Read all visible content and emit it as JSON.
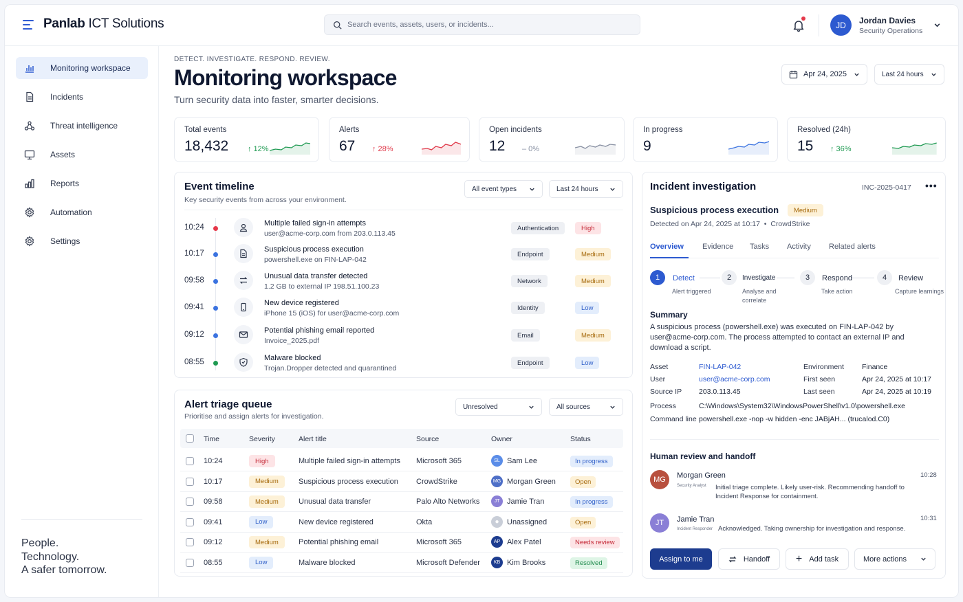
{
  "brand": {
    "name_bold": "Panlab",
    "name_rest": " ICT Solutions"
  },
  "search": {
    "placeholder": "Search events, assets, users, or incidents..."
  },
  "user": {
    "initials": "JD",
    "name": "Jordan Davies",
    "role": "Security Operations"
  },
  "sidebar": {
    "items": [
      {
        "label": "Monitoring workspace",
        "icon": "bar-chart-icon"
      },
      {
        "label": "Incidents",
        "icon": "document-icon"
      },
      {
        "label": "Threat intelligence",
        "icon": "network-icon"
      },
      {
        "label": "Assets",
        "icon": "monitor-icon"
      },
      {
        "label": "Reports",
        "icon": "reports-icon"
      },
      {
        "label": "Automation",
        "icon": "gear-icon"
      },
      {
        "label": "Settings",
        "icon": "settings-icon"
      }
    ],
    "tagline": [
      "People.",
      "Technology.",
      "A safer tomorrow."
    ]
  },
  "header": {
    "eyebrow": "DETECT. INVESTIGATE. RESPOND. REVIEW.",
    "title": "Monitoring workspace",
    "subtitle": "Turn security data into faster, smarter decisions.",
    "date": "Apr 24, 2025",
    "range": "Last 24 hours"
  },
  "kpis": [
    {
      "label": "Total events",
      "value": "18,432",
      "delta": "12%",
      "dir": "up",
      "color": "#1f9a52"
    },
    {
      "label": "Alerts",
      "value": "67",
      "delta": "28%",
      "dir": "up",
      "color": "#e0394a"
    },
    {
      "label": "Open incidents",
      "value": "12",
      "delta": "0%",
      "dir": "flat",
      "color": "#8a92a4"
    },
    {
      "label": "In progress",
      "value": "9",
      "delta": "",
      "dir": "none",
      "color": "#3b73e0"
    },
    {
      "label": "Resolved (24h)",
      "value": "15",
      "delta": "36%",
      "dir": "up",
      "color": "#1f9a52"
    }
  ],
  "timeline": {
    "title": "Event timeline",
    "subtitle": "Key security events from across your environment.",
    "filter_type": "All event types",
    "filter_range": "Last 24 hours",
    "events": [
      {
        "time": "10:24",
        "dot": "#e5384a",
        "icon": "user-icon",
        "title": "Multiple failed sign-in attempts",
        "desc": "user@acme-corp.com from 203.0.113.45",
        "category": "Authentication",
        "severity": "High"
      },
      {
        "time": "10:17",
        "dot": "#3b73e0",
        "icon": "file-icon",
        "title": "Suspicious process execution",
        "desc": "powershell.exe on FIN-LAP-042",
        "category": "Endpoint",
        "severity": "Medium"
      },
      {
        "time": "09:58",
        "dot": "#3b73e0",
        "icon": "transfer-icon",
        "title": "Unusual data transfer detected",
        "desc": "1.2 GB to external IP 198.51.100.23",
        "category": "Network",
        "severity": "Medium"
      },
      {
        "time": "09:41",
        "dot": "#3b73e0",
        "icon": "phone-icon",
        "title": "New device registered",
        "desc": "iPhone 15 (iOS) for user@acme-corp.com",
        "category": "Identity",
        "severity": "Low"
      },
      {
        "time": "09:12",
        "dot": "#3b73e0",
        "icon": "mail-icon",
        "title": "Potential phishing email reported",
        "desc": "Invoice_2025.pdf",
        "category": "Email",
        "severity": "Medium"
      },
      {
        "time": "08:55",
        "dot": "#1f9a52",
        "icon": "shield-icon",
        "title": "Malware blocked",
        "desc": "Trojan.Dropper detected and quarantined",
        "category": "Endpoint",
        "severity": "Low"
      }
    ]
  },
  "triage": {
    "title": "Alert triage queue",
    "subtitle": "Prioritise and assign alerts for investigation.",
    "filter_status": "Unresolved",
    "filter_source": "All sources",
    "columns": [
      "Time",
      "Severity",
      "Alert title",
      "Source",
      "Owner",
      "Status"
    ],
    "rows": [
      {
        "time": "10:24",
        "severity": "High",
        "title": "Multiple failed sign-in attempts",
        "source": "Microsoft 365",
        "owner": "Sam Lee",
        "owner_initials": "SL",
        "owner_color": "#5b8de8",
        "status": "In progress",
        "status_class": "st-prog"
      },
      {
        "time": "10:17",
        "severity": "Medium",
        "title": "Suspicious process execution",
        "source": "CrowdStrike",
        "owner": "Morgan Green",
        "owner_initials": "MG",
        "owner_color": "#4e6fc7",
        "status": "Open",
        "status_class": "st-open"
      },
      {
        "time": "09:58",
        "severity": "Medium",
        "title": "Unusual data transfer",
        "source": "Palo Alto Networks",
        "owner": "Jamie Tran",
        "owner_initials": "JT",
        "owner_color": "#8a7fd6",
        "status": "In progress",
        "status_class": "st-prog"
      },
      {
        "time": "09:41",
        "severity": "Low",
        "title": "New device registered",
        "source": "Okta",
        "owner": "Unassigned",
        "owner_initials": "",
        "owner_color": "#c9ced8",
        "status": "Open",
        "status_class": "st-open"
      },
      {
        "time": "09:12",
        "severity": "Medium",
        "title": "Potential phishing email",
        "source": "Microsoft 365",
        "owner": "Alex Patel",
        "owner_initials": "AP",
        "owner_color": "#1d3c8f",
        "status": "Needs review",
        "status_class": "st-review"
      },
      {
        "time": "08:55",
        "severity": "Low",
        "title": "Malware blocked",
        "source": "Microsoft Defender",
        "owner": "Kim Brooks",
        "owner_initials": "KB",
        "owner_color": "#1d3c8f",
        "status": "Resolved",
        "status_class": "st-resolved"
      }
    ]
  },
  "incident": {
    "title": "Incident investigation",
    "id": "INC-2025-0417",
    "name": "Suspicious process execution",
    "severity": "Medium",
    "detected": "Detected on Apr 24, 2025 at 10:17",
    "source": "CrowdStrike",
    "tabs": [
      "Overview",
      "Evidence",
      "Tasks",
      "Activity",
      "Related alerts"
    ],
    "steps": [
      {
        "num": "1",
        "name": "Detect",
        "sub": "Alert triggered"
      },
      {
        "num": "2",
        "name": "Investigate",
        "sub": "Analyse and correlate"
      },
      {
        "num": "3",
        "name": "Respond",
        "sub": "Take action"
      },
      {
        "num": "4",
        "name": "Review",
        "sub": "Capture learnings"
      }
    ],
    "summary_title": "Summary",
    "summary": "A suspicious process (powershell.exe) was executed on FIN-LAP-042 by user@acme-corp.com. The process attempted to contact an external IP and download a script.",
    "details": {
      "asset_label": "Asset",
      "asset": "FIN-LAP-042",
      "user_label": "User",
      "user": "user@acme-corp.com",
      "ip_label": "Source IP",
      "ip": "203.0.113.45",
      "env_label": "Environment",
      "env": "Finance",
      "first_label": "First seen",
      "first": "Apr 24, 2025 at 10:17",
      "last_label": "Last seen",
      "last": "Apr 24, 2025 at 10:19",
      "process_label": "Process",
      "process": "C:\\Windows\\System32\\WindowsPowerShell\\v1.0\\powershell.exe",
      "cmd_label": "Command line",
      "cmd": "powershell.exe -nop -w hidden -enc JABjAH... (trucalod.C0)"
    },
    "review_title": "Human review and handoff",
    "comments": [
      {
        "initials": "MG",
        "name": "Morgan Green",
        "role": "Security Analyst",
        "time": "10:28",
        "text": "Initial triage complete. Likely user-risk. Recommending handoff to Incident Response for containment."
      },
      {
        "initials": "JT",
        "name": "Jamie Tran",
        "role": "Incident Responder",
        "time": "10:31",
        "text": "Acknowledged. Taking ownership for investigation and response."
      }
    ],
    "actions": {
      "assign": "Assign to me",
      "handoff": "Handoff",
      "add_task": "Add task",
      "more": "More actions"
    }
  }
}
